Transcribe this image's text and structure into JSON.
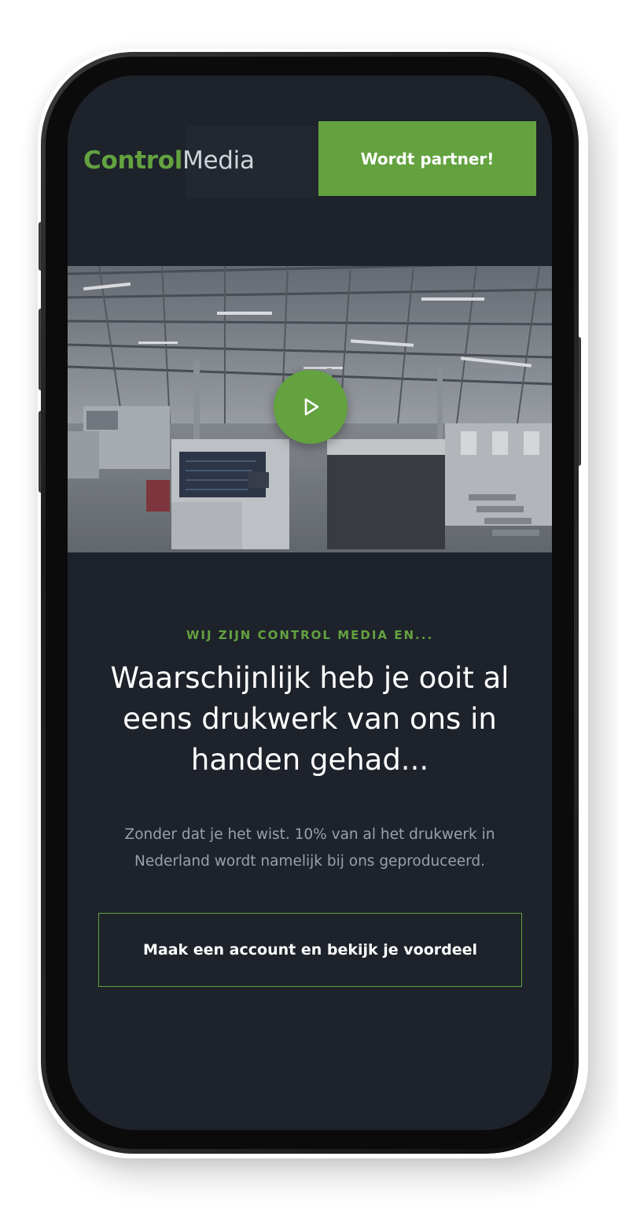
{
  "brand": {
    "name_strong": "Control",
    "name_light": "Media",
    "accent_color": "#63a23f",
    "background_color": "#1e222b"
  },
  "header": {
    "cta_label": "Wordt partner!"
  },
  "video": {
    "play_icon": "play-icon"
  },
  "hero": {
    "eyebrow": "WIJ ZIJN CONTROL MEDIA EN...",
    "headline": "Waarschijnlijk heb je ooit al eens drukwerk van ons in handen gehad...",
    "body": "Zonder dat je het wist. 10% van al het drukwerk in Nederland wordt namelijk bij ons geproduceerd.",
    "cta_label": "Maak een account en bekijk je voordeel"
  }
}
